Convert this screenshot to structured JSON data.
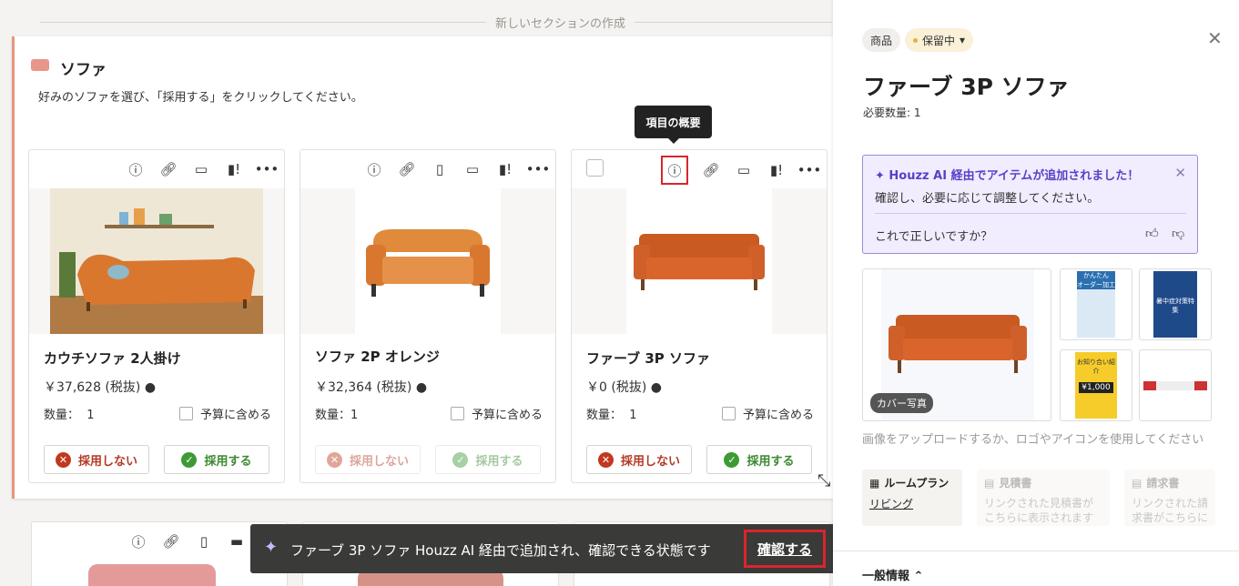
{
  "divider": {
    "label": "新しいセクションの作成"
  },
  "section": {
    "title": "ソファ",
    "description": "好みのソファを選び、「採用する」をクリックしてください。"
  },
  "tooltip": {
    "text": "項目の概要"
  },
  "cards": [
    {
      "name": "カウチソファ 2人掛け",
      "price": "￥37,628 (税抜)",
      "qty_label": "数量：",
      "qty": "1",
      "budget": "予算に含める",
      "reject": "採用しない",
      "accept": "採用する"
    },
    {
      "name": "ソファ 2P オレンジ",
      "price": "￥32,364 (税抜)",
      "qty_label": "数量：",
      "qty": "1",
      "budget": "予算に含める",
      "reject": "採用しない",
      "accept": "採用する"
    },
    {
      "name": "ファーブ 3P ソファ",
      "price": "￥0 (税抜)",
      "qty_label": "数量：",
      "qty": "1",
      "budget": "予算に含める",
      "reject": "採用しない",
      "accept": "採用する"
    }
  ],
  "toast": {
    "message": "ファーブ 3P ソファ Houzz AI 経由で追加され、確認できる状態です",
    "confirm": "確認する",
    "close": "✕"
  },
  "panel": {
    "tag_kind": "商品",
    "tag_status": "保留中",
    "title": "ファーブ 3P ソファ",
    "required_qty": "必要数量: 1",
    "ai_title": "Houzz AI 経由でアイテムが追加されました！",
    "ai_desc": "確認し、必要に応じて調整してください。",
    "ai_question": "これで正しいですか？",
    "cover_label": "カバー写真",
    "thumbs": [
      {
        "line1": "かんたん",
        "line2": "オーダー加工"
      },
      {
        "line1": "",
        "line2": "暑中症対策特集"
      },
      {
        "line1": "お知り合い紹介",
        "line2": "¥1,000"
      },
      {
        "line1": "",
        "line2": ""
      }
    ],
    "upload_note": "画像をアップロードするか、ロゴやアイコンを使用してください",
    "tabs": [
      {
        "title": "ルームプラン",
        "body": "リビング"
      },
      {
        "title": "見積書",
        "body": "リンクされた見積書がこちらに表示されます"
      },
      {
        "title": "請求書",
        "body": "リンクされた請求書がこちらに表示されます"
      }
    ],
    "general": "一般情報"
  },
  "colors": {
    "accent_red": "#d8262c",
    "ai_purple": "#5b3fc7",
    "sofa_orange": "#d9772f"
  }
}
